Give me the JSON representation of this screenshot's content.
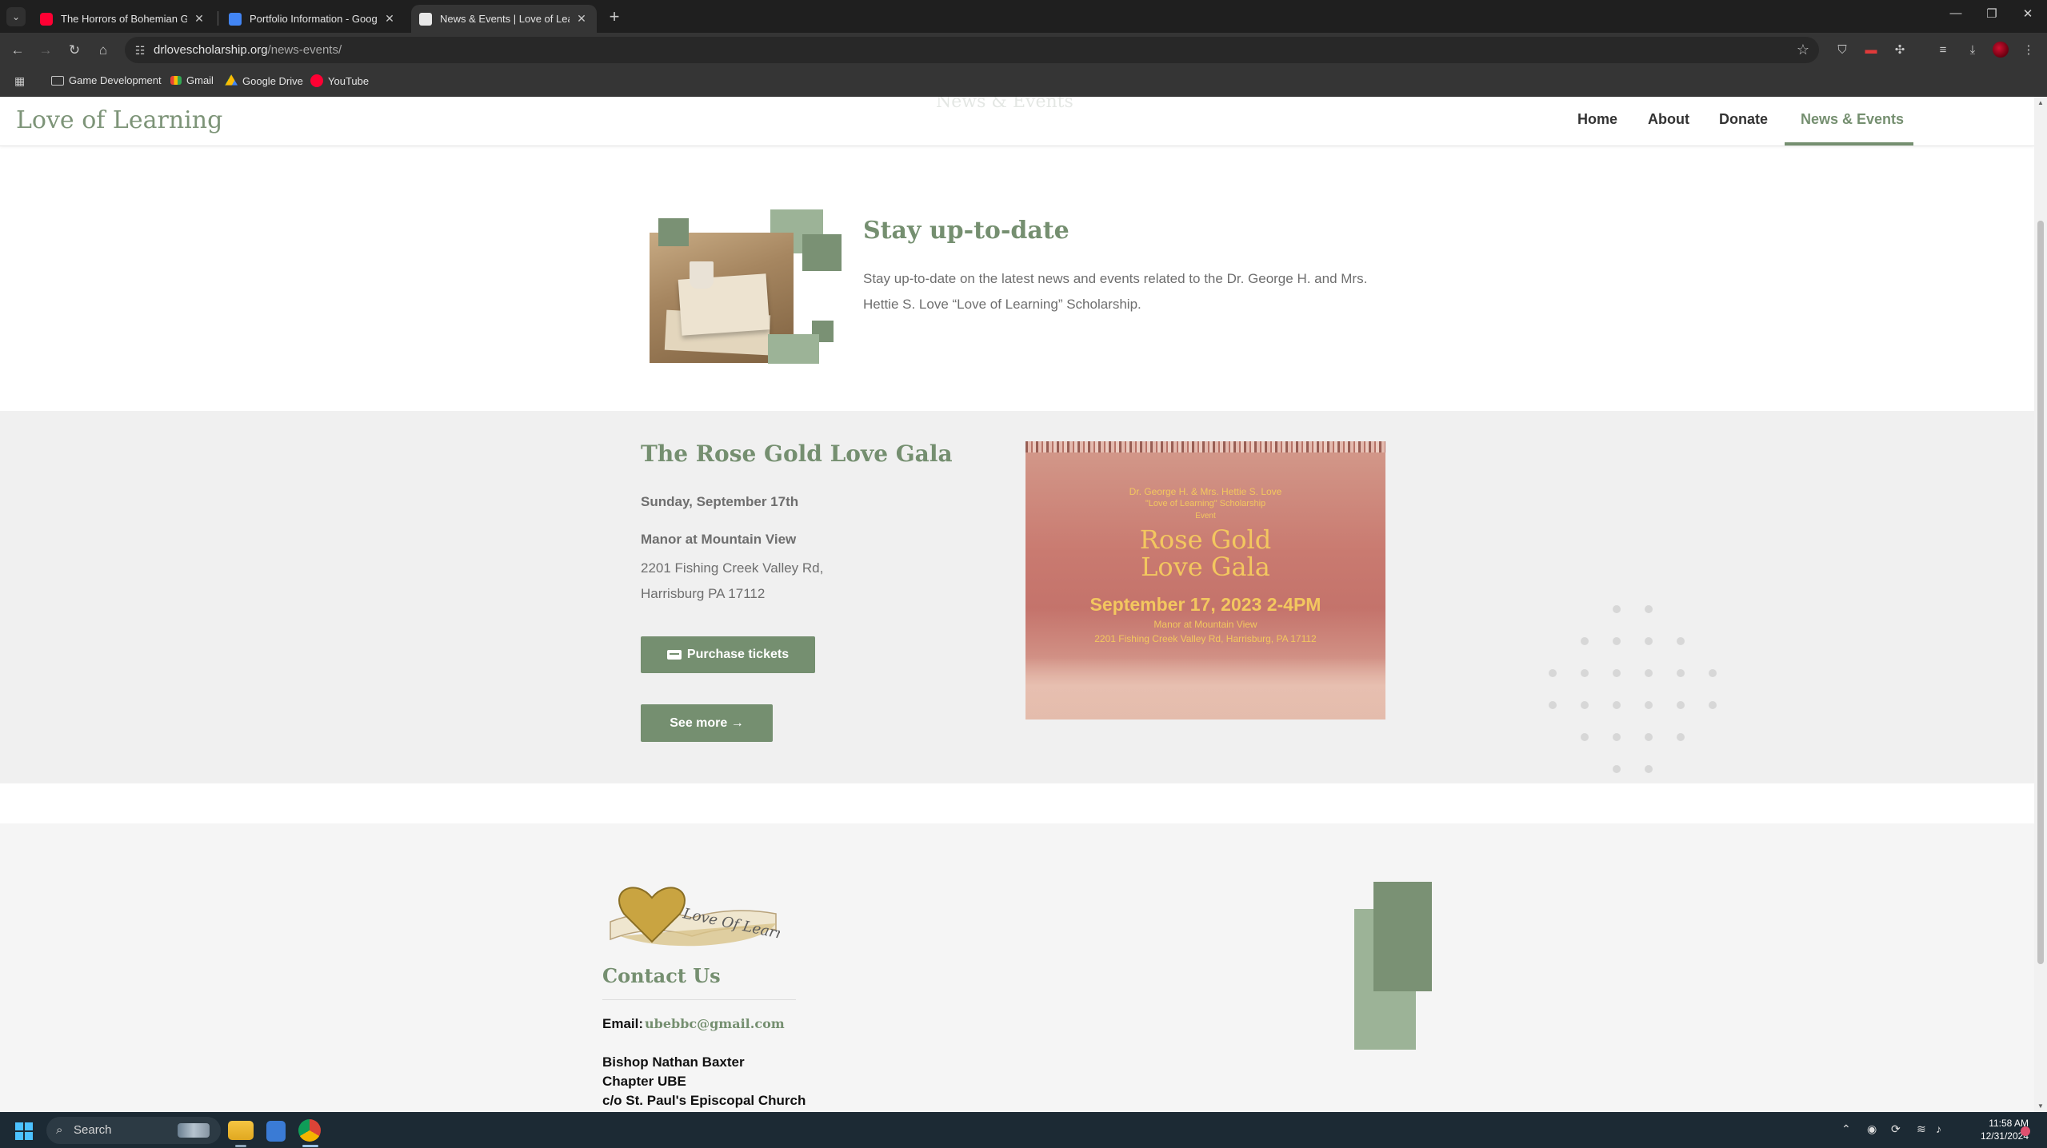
{
  "browser": {
    "tabs": [
      {
        "title": "The Horrors of Bohemian Grove",
        "icon": "youtube-icon",
        "active": false
      },
      {
        "title": "Portfolio Information - Google",
        "icon": "google-docs-icon",
        "active": false
      },
      {
        "title": "News & Events | Love of Learning",
        "icon": "site-favicon-icon",
        "active": true
      }
    ],
    "new_tab_label": "+",
    "url_host": "drlovescholarship.org",
    "url_path": "/news-events/",
    "bookmarks": [
      {
        "label": "Game Development",
        "icon": "folder-icon"
      },
      {
        "label": "Gmail",
        "icon": "gmail-icon"
      },
      {
        "label": "Google Drive",
        "icon": "google-drive-icon"
      },
      {
        "label": "YouTube",
        "icon": "youtube-icon"
      }
    ]
  },
  "site": {
    "logo": "Love of Learning",
    "ghost_title": "News & Events",
    "nav": [
      {
        "label": "Home",
        "current": false
      },
      {
        "label": "About",
        "current": false
      },
      {
        "label": "Donate",
        "current": false
      },
      {
        "label": "News & Events",
        "current": true
      }
    ],
    "intro": {
      "title": "Stay up-to-date",
      "text": "Stay up-to-date on the latest news and events related to the Dr. George H. and Mrs. Hettie S. Love “Love of Learning” Scholarship."
    },
    "event": {
      "title": "The Rose Gold Love Gala",
      "date": "Sunday, September 17th",
      "venue": "Manor at Mountain View",
      "address_line1": "2201 Fishing Creek Valley Rd,",
      "address_line2": "Harrisburg PA 17112",
      "purchase_label": "Purchase tickets",
      "see_more_label": "See more →",
      "flyer": {
        "line1": "Dr. George H. & Mrs. Hettie S. Love",
        "line2": "\"Love of Learning\" Scholarship",
        "line3": "Event",
        "line4": "Rose Gold",
        "line5": "Love Gala",
        "line6": "September 17, 2023 2-4PM",
        "line7": "Manor at Mountain View",
        "line8": "2201 Fishing Creek Valley Rd, Harrisburg, PA 17112"
      }
    },
    "footer": {
      "logo_text": "Love Of Learning",
      "title": "Contact Us",
      "email_label": "Email:",
      "email": "ubebbc@gmail.com",
      "address": [
        "Bishop Nathan Baxter",
        "Chapter UBE",
        "c/o St. Paul's Episcopal Church"
      ]
    },
    "colors": {
      "accent": "#758f70",
      "accent_light": "#9cb397",
      "band_gray": "#f0f0f0"
    }
  },
  "taskbar": {
    "search_placeholder": "Search",
    "time": "11:58 AM",
    "date": "12/31/2024"
  }
}
